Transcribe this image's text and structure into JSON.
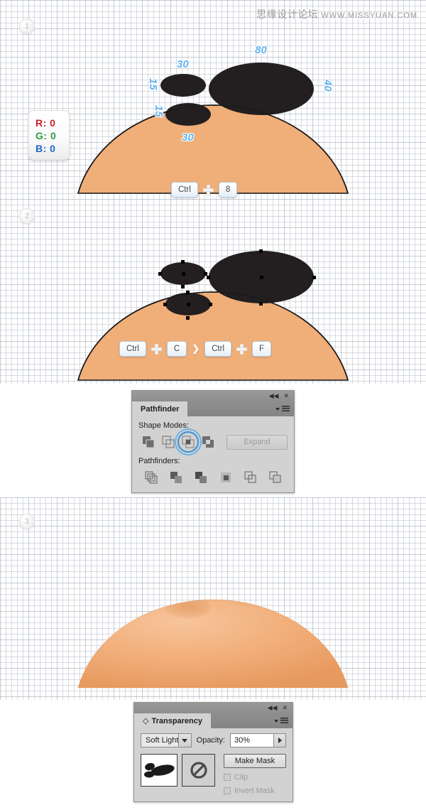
{
  "watermark": {
    "cn": "思缘设计论坛",
    "url": "WWW.MISSYUAN.COM"
  },
  "steps": [
    {
      "number": "1"
    },
    {
      "number": "2"
    },
    {
      "number": "3"
    }
  ],
  "color_badge": {
    "r_label": "R: 0",
    "g_label": "G: 0",
    "b_label": "B: 0",
    "r_color": "#cc2026",
    "g_color": "#2e9e45",
    "b_color": "#2266c4"
  },
  "measurements": [
    {
      "value": "30",
      "orientation": "horizontal"
    },
    {
      "value": "15",
      "orientation": "vertical"
    },
    {
      "value": "15",
      "orientation": "vertical"
    },
    {
      "value": "30",
      "orientation": "horizontal"
    },
    {
      "value": "80",
      "orientation": "horizontal"
    },
    {
      "value": "40",
      "orientation": "vertical"
    }
  ],
  "shortcut_step1": {
    "key1": "Ctrl",
    "key2": "8"
  },
  "shortcut_step2": {
    "key1": "Ctrl",
    "key2": "C",
    "separator": "❯",
    "key3": "Ctrl",
    "key4": "F"
  },
  "pathfinder_panel": {
    "tab_label": "Pathfinder",
    "collapse_icon": "◀◀",
    "close_icon": "✕",
    "shape_modes_label": "Shape Modes:",
    "pathfinders_label": "Pathfinders:",
    "expand_label": "Expand",
    "shape_modes": [
      {
        "name": "unite",
        "selected": false
      },
      {
        "name": "minus-front",
        "selected": false
      },
      {
        "name": "intersect",
        "selected": true
      },
      {
        "name": "exclude",
        "selected": false
      }
    ],
    "pathfinders": [
      {
        "name": "divide"
      },
      {
        "name": "trim"
      },
      {
        "name": "merge"
      },
      {
        "name": "crop"
      },
      {
        "name": "outline"
      },
      {
        "name": "minus-back"
      }
    ],
    "selected_accent": "#3a8fd6"
  },
  "transparency_panel": {
    "tab_label": "Transparency",
    "collapse_icon": "◀◀",
    "close_icon": "✕",
    "blend_mode": "Soft Light",
    "opacity_label": "Opacity:",
    "opacity_value": "30%",
    "make_mask_label": "Make Mask",
    "clip_label": "Clip",
    "invert_mask_label": "Invert Mask",
    "clip_checked": false,
    "invert_checked": false
  },
  "illustration": {
    "skin_color": "#f0ae78",
    "shape_color": "#231f20",
    "outline_color": "#1a1a1a",
    "step1_caption": "black ellipses placed over the skin dome",
    "step3_caption": "soft-light shaded dome result"
  }
}
